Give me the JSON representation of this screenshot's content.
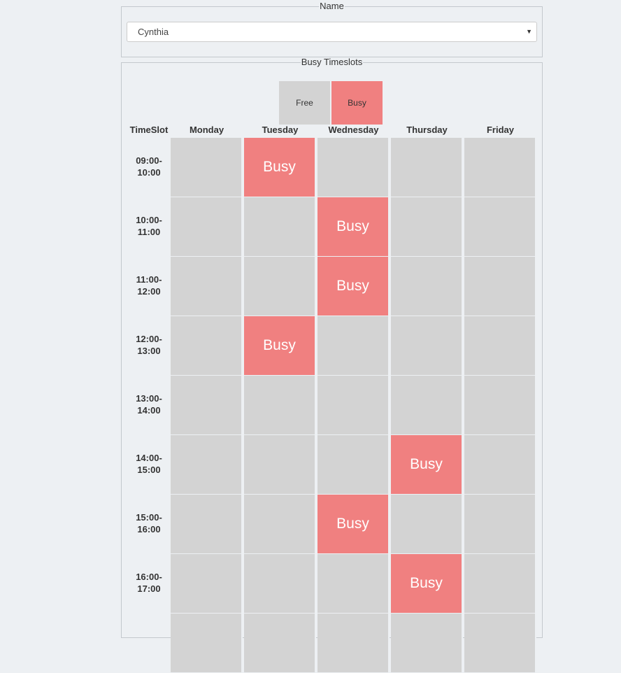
{
  "name_section": {
    "legend": "Name",
    "selected_name": "Cynthia"
  },
  "busy_section": {
    "legend": "Busy Timeslots",
    "key": {
      "free": "Free",
      "busy": "Busy"
    },
    "header_timeslot": "TimeSlot",
    "days": [
      "Monday",
      "Tuesday",
      "Wednesday",
      "Thursday",
      "Friday"
    ],
    "busy_label": "Busy",
    "slots": [
      {
        "start": "09:00-",
        "end": "10:00",
        "busy": [
          false,
          true,
          false,
          false,
          false
        ]
      },
      {
        "start": "10:00-",
        "end": "11:00",
        "busy": [
          false,
          false,
          true,
          false,
          false
        ]
      },
      {
        "start": "11:00-",
        "end": "12:00",
        "busy": [
          false,
          false,
          true,
          false,
          false
        ]
      },
      {
        "start": "12:00-",
        "end": "13:00",
        "busy": [
          false,
          true,
          false,
          false,
          false
        ]
      },
      {
        "start": "13:00-",
        "end": "14:00",
        "busy": [
          false,
          false,
          false,
          false,
          false
        ]
      },
      {
        "start": "14:00-",
        "end": "15:00",
        "busy": [
          false,
          false,
          false,
          true,
          false
        ]
      },
      {
        "start": "15:00-",
        "end": "16:00",
        "busy": [
          false,
          false,
          true,
          false,
          false
        ]
      },
      {
        "start": "16:00-",
        "end": "17:00",
        "busy": [
          false,
          false,
          false,
          true,
          false
        ]
      }
    ]
  },
  "colors": {
    "free": "#d3d3d3",
    "busy": "#f08080",
    "background": "#edf0f3"
  }
}
